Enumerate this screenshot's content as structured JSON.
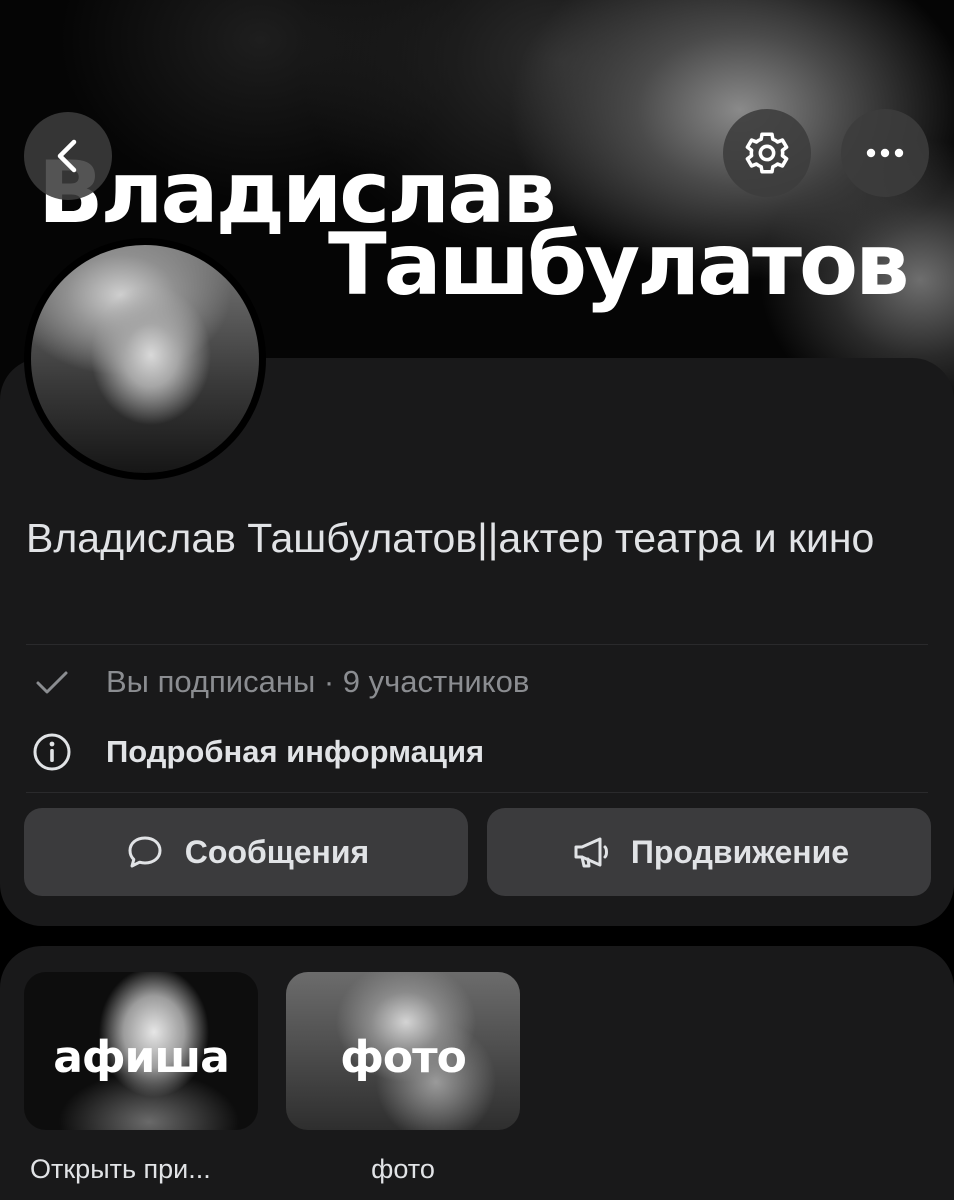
{
  "cover": {
    "title_line1": "Владислав",
    "title_line2": "Ташбулатов"
  },
  "header": {
    "back_icon": "chevron-left-icon",
    "settings_icon": "gear-icon",
    "more_icon": "more-horizontal-icon"
  },
  "group": {
    "name": "Владислав Ташбулатов||актер театра и кино",
    "subscription_status": "Вы подписаны · 9 участников",
    "details_label": "Подробная информация"
  },
  "actions": {
    "messages_label": "Сообщения",
    "promotion_label": "Продвижение"
  },
  "apps": [
    {
      "thumb_text": "афиша",
      "caption": "Открыть при..."
    },
    {
      "thumb_text": "фото",
      "caption": "фото"
    }
  ],
  "colors": {
    "background": "#000000",
    "card": "#19191a",
    "button": "#3b3b3d",
    "text_primary": "#e1e3e6",
    "text_secondary": "#8b8d91"
  }
}
